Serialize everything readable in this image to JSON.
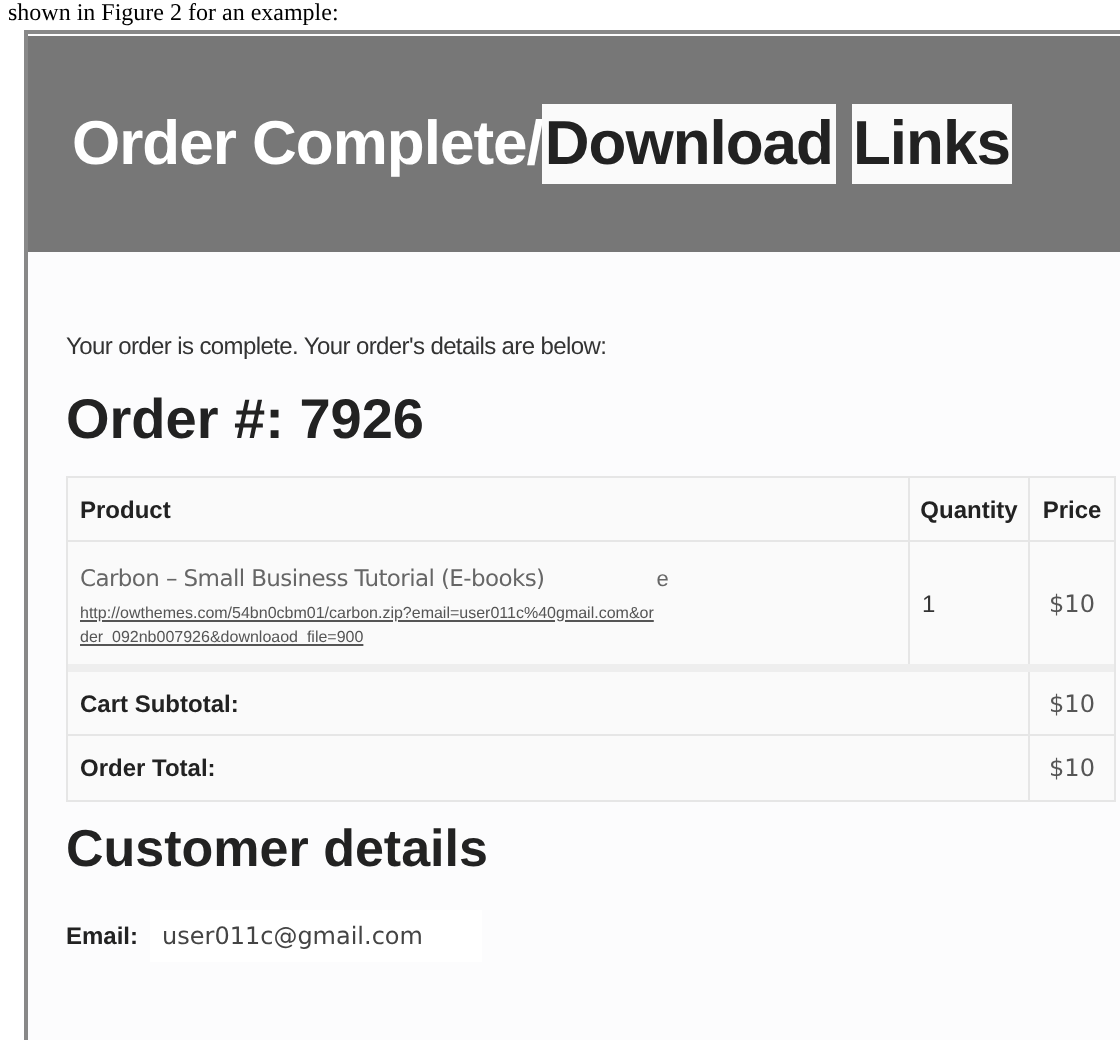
{
  "caption": "shown in Figure 2 for an example:",
  "header": {
    "title_parts": [
      {
        "text": "Order Complete/",
        "highlighted": false
      },
      {
        "text": "Download",
        "highlighted": true
      },
      {
        "text": "Links",
        "highlighted": true
      }
    ]
  },
  "intro": "Your order is complete. Your order's details are below:",
  "order_heading": "Order #: 7926",
  "table": {
    "columns": [
      "Product",
      "Quantity",
      "Price"
    ],
    "rows": [
      {
        "product": "Carbon – Small Business Tutorial (E-books)",
        "fragment": "e",
        "link": "http://owthemes.com/54bn0cbm01/carbon.zip?email=user011c%40gmail.com&order_092nb007926&downloaod_file=900",
        "quantity": "1",
        "price": "$10"
      }
    ],
    "totals": [
      {
        "label": "Cart Subtotal:",
        "value": "$10"
      },
      {
        "label": "Order Total:",
        "value": "$10"
      }
    ]
  },
  "customer": {
    "heading": "Customer details",
    "email_label": "Email:",
    "email": "user011c@gmail.com"
  }
}
